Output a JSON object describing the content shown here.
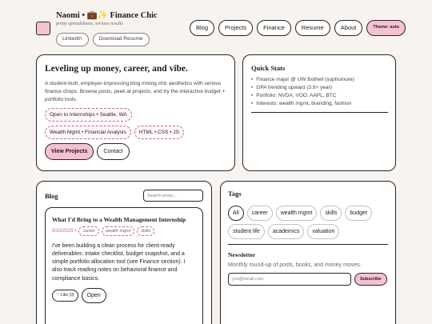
{
  "header": {
    "brand": "Naomi • 💼✨ Finance Chic",
    "tagline": "pretty spreadsheets, serious results",
    "links": [
      "LinkedIn",
      "Download Resume"
    ],
    "nav": [
      "Blog",
      "Projects",
      "Finance",
      "Resume",
      "About"
    ],
    "theme_label": "Theme: auto"
  },
  "hero": {
    "title": "Leveling up money, career, and vibe.",
    "description": "A student-built, employer-impressing blog mixing chic aesthetics with serious finance chops. Browse posts, peek at projects, and try the interactive budget + portfolio tools.",
    "chips": [
      "Open to Internships • Seattle, WA",
      "Wealth Mgmt • Financial Analysis",
      "HTML • CSS • JS"
    ],
    "primary_button": "View Projects",
    "secondary_button": "Contact"
  },
  "stats": {
    "title": "Quick Stats",
    "items": [
      "Finance major @ UW Bothell (sophomore)",
      "GPA trending upward (3.8+ year)",
      "Portfolio: NVDA, VOO, AAPL, BTC",
      "Interests: wealth mgmt, branding, fashion"
    ]
  },
  "blog": {
    "title": "Blog",
    "search_placeholder": "Search posts...",
    "post": {
      "title": "What I'd Bring to a Wealth Management Internship",
      "date": "8/10/2025 •",
      "tags": [
        "career",
        "wealth mgmt",
        "skills"
      ],
      "body": "I've been building a clean process for client-ready deliverables: intake checklist, budget snapshot, and a simple portfolio allocation tool (see Finance section). I also track reading notes on behavioral finance and compliance basics.",
      "like_label": "♡ Like (0)",
      "open_label": "Open"
    }
  },
  "tags": {
    "title": "Tags",
    "items": [
      "All",
      "career",
      "wealth mgmt",
      "skills",
      "budget",
      "student life",
      "academics",
      "valuation"
    ],
    "newsletter_title": "Newsletter",
    "newsletter_desc": "Monthly round-up of posts, books, and money moves.",
    "email_placeholder": "you@email.com",
    "subscribe_label": "Subscribe"
  }
}
